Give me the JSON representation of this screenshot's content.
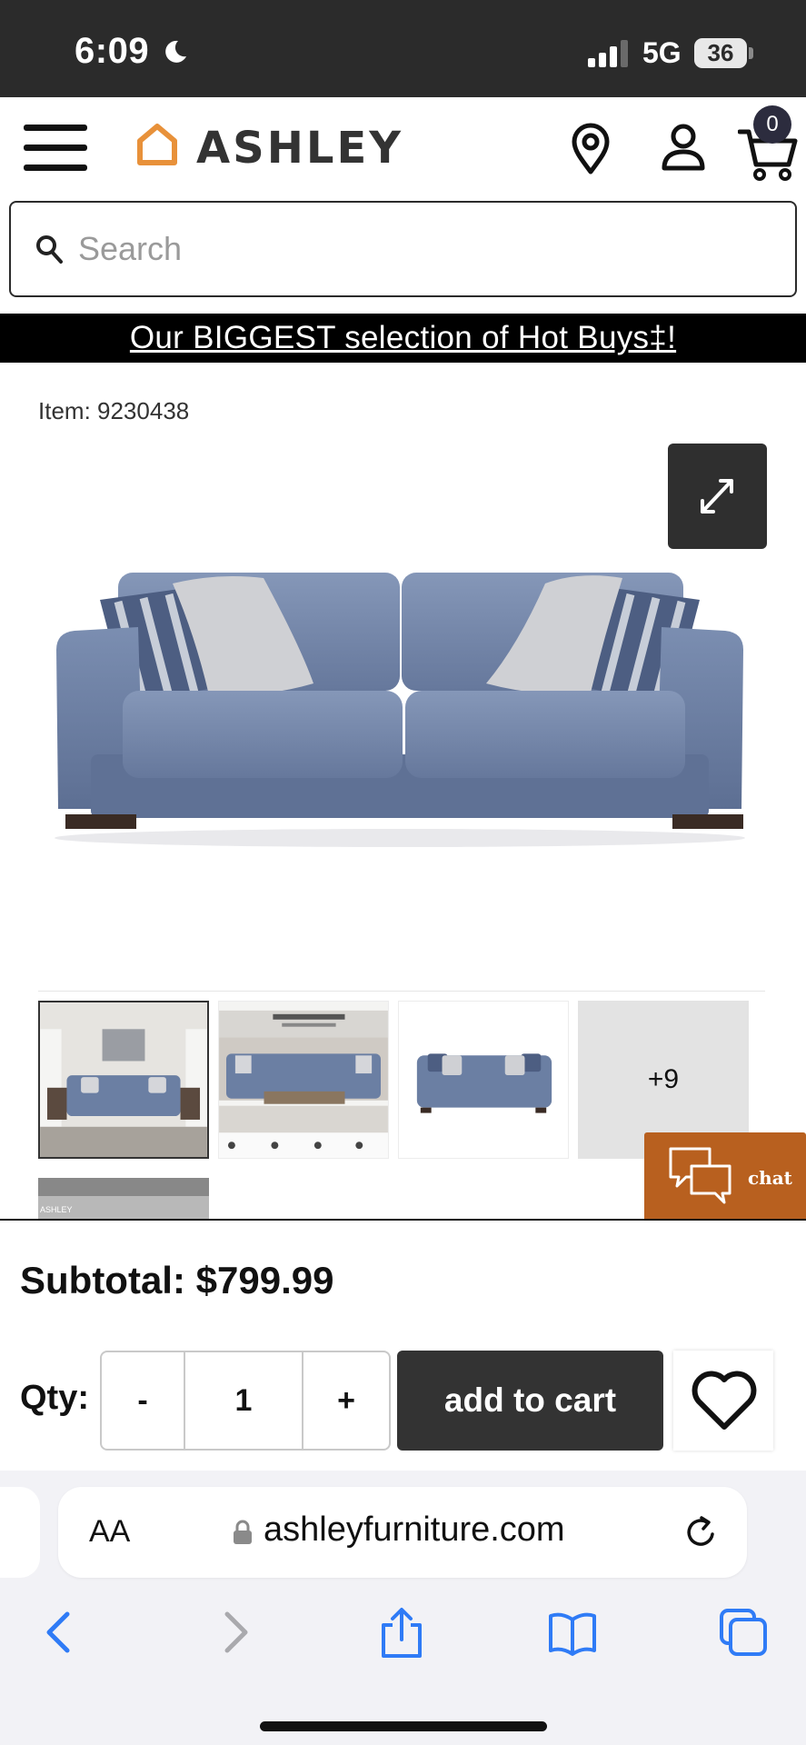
{
  "status_bar": {
    "time": "6:09",
    "network": "5G",
    "battery": "36"
  },
  "header": {
    "logo_text": "Ashley",
    "cart_count": "0",
    "brand_color": "#E8913A"
  },
  "search": {
    "placeholder": "Search",
    "value": ""
  },
  "promo": {
    "text": "Our BIGGEST selection of Hot Buys‡!"
  },
  "product": {
    "item_label": "Item: 9230438",
    "gallery_more_label": "+9",
    "partial_thumb_text": "ASHLEY",
    "sofa_color": "#6b7fa3"
  },
  "chat": {
    "label": "chat",
    "color": "#B8601F"
  },
  "purchase": {
    "subtotal": "Subtotal: $799.99",
    "qty_label": "Qty:",
    "qty_minus": "-",
    "qty_value": "1",
    "qty_plus": "+",
    "add_to_cart": "add to cart"
  },
  "browser": {
    "text_size_label": "AA",
    "url": "ashleyfurniture.com"
  }
}
